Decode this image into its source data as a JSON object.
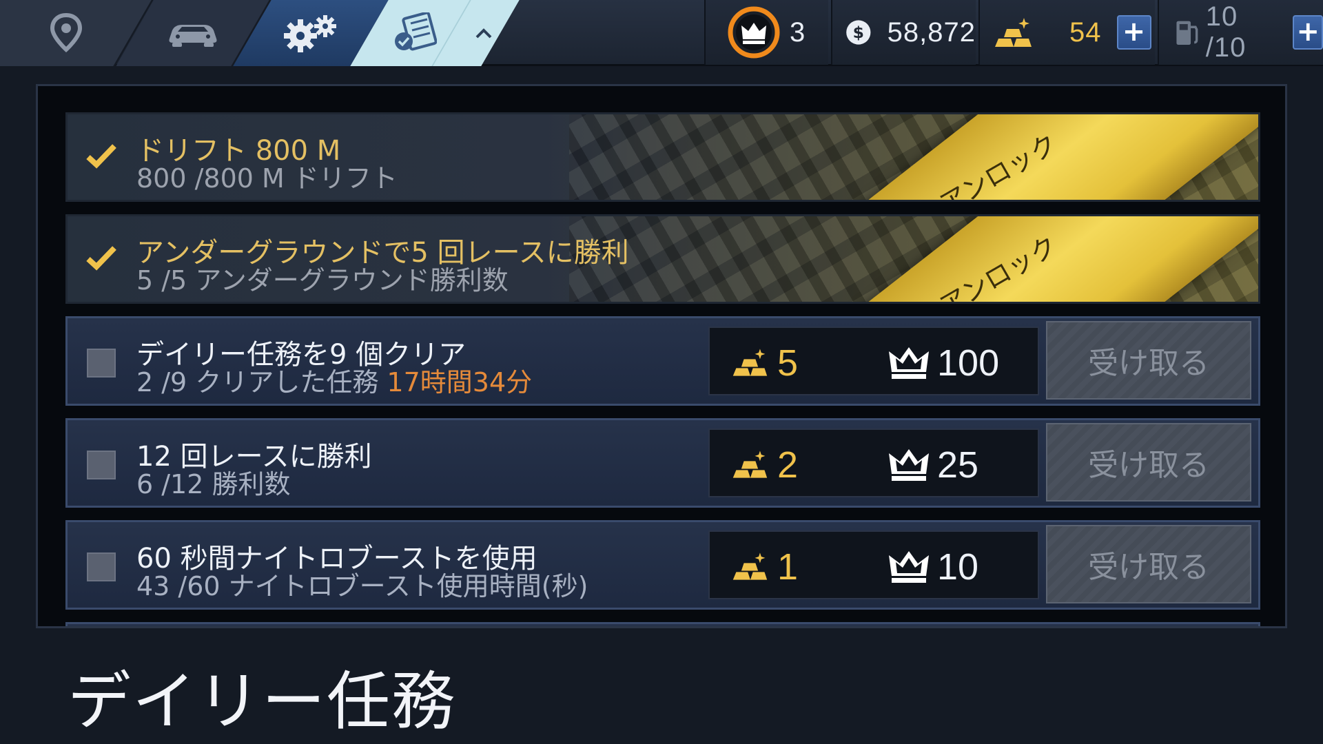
{
  "nav": {
    "tabs": [
      {
        "name": "map",
        "icon": "map-pin-icon"
      },
      {
        "name": "garage",
        "icon": "car-icon"
      },
      {
        "name": "tuning",
        "icon": "gears-icon"
      },
      {
        "name": "tasks",
        "icon": "clipboard-icon",
        "active": true
      }
    ]
  },
  "resources": {
    "crowns": "3",
    "cash": "58,872",
    "gold": "54",
    "fuel": "10 /10"
  },
  "missions": [
    {
      "title": "ドリフト 800 M",
      "progress": "800 /800 M ドリフト",
      "status": "unlocked",
      "ribbon": "アンロック"
    },
    {
      "title": "アンダーグラウンドで5 回レースに勝利",
      "progress": "5 /5 アンダーグラウンド勝利数",
      "status": "unlocked",
      "ribbon": "アンロック"
    },
    {
      "title": "デイリー任務を9 個クリア",
      "progress": "2 /9 クリアした任務",
      "timer": "17時間34分",
      "gold": "5",
      "crowns": "100",
      "claim": "受け取る"
    },
    {
      "title": "12 回レースに勝利",
      "progress": "6 /12 勝利数",
      "gold": "2",
      "crowns": "25",
      "claim": "受け取る"
    },
    {
      "title": "60 秒間ナイトロブーストを使用",
      "progress": "43 /60 ナイトロブースト使用時間(秒)",
      "gold": "1",
      "crowns": "10",
      "claim": "受け取る"
    }
  ],
  "page_title": "デイリー任務",
  "colors": {
    "gold": "#f0c24b",
    "timer": "#e58a3a",
    "ribbon": "#f4d95a",
    "active_tab": "#c6e6ee"
  }
}
